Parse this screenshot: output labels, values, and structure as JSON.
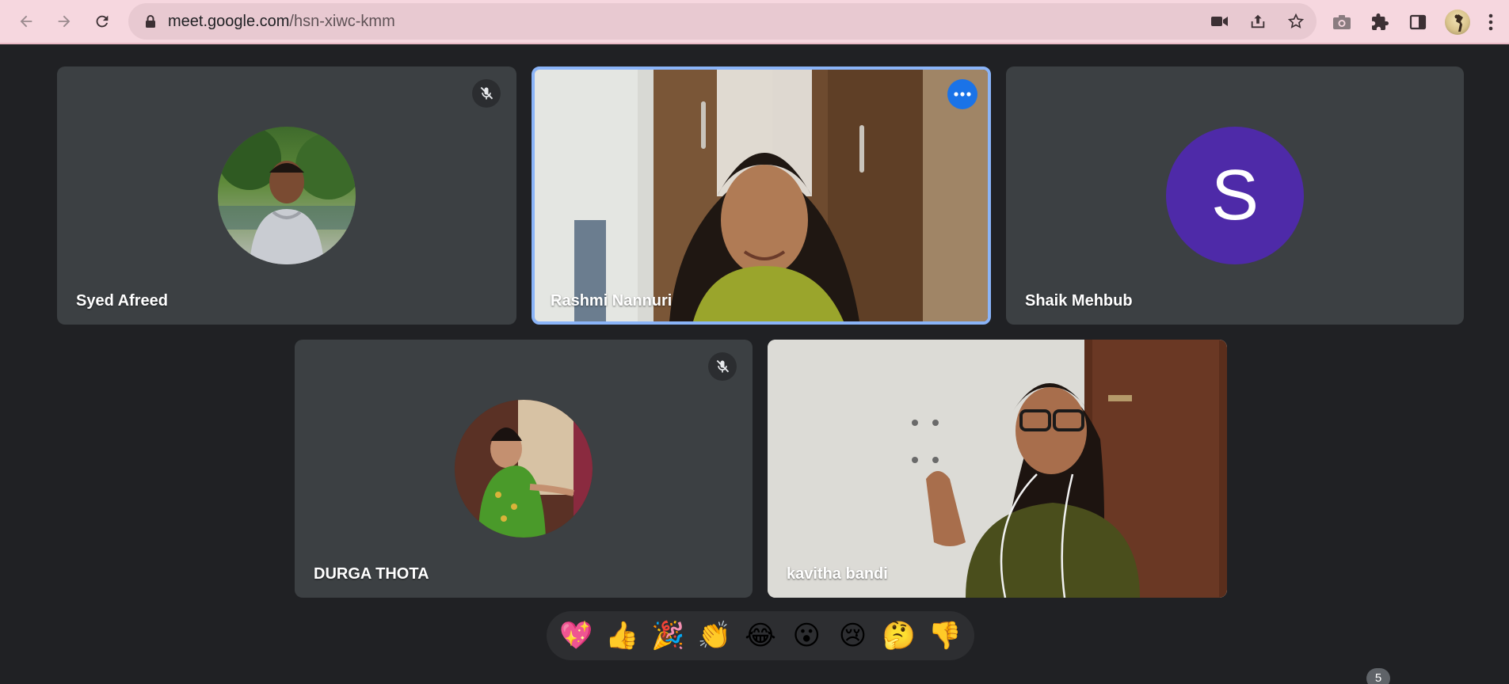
{
  "browser": {
    "url_host": "meet.google.com",
    "url_path": "/hsn-xiwc-kmm",
    "icons": [
      "back-icon",
      "forward-icon",
      "reload-icon",
      "lock-icon",
      "camera-icon",
      "share-icon",
      "star-icon",
      "screenshot-icon",
      "extensions-icon",
      "side-panel-icon",
      "profile-avatar",
      "menu-icon"
    ]
  },
  "participants": [
    {
      "name": "Syed Afreed",
      "muted": true,
      "video": false
    },
    {
      "name": "Rashmi Nannuri",
      "muted": false,
      "video": true,
      "active": true
    },
    {
      "name": "Shaik Mehbub",
      "muted": false,
      "video": false,
      "initial": "S",
      "avatar_color": "#4e2aa8"
    },
    {
      "name": "DURGA THOTA",
      "muted": true,
      "video": false
    },
    {
      "name": "kavitha bandi",
      "muted": false,
      "video": true
    }
  ],
  "reactions": [
    "💖",
    "👍",
    "🎉",
    "👏",
    "😂",
    "😮",
    "😢",
    "🤔",
    "👎"
  ],
  "people_count": "5",
  "colors": {
    "accent": "#1a73e8",
    "tile": "#3c4043",
    "background": "#202124",
    "toolbar": "#f6d7df"
  }
}
